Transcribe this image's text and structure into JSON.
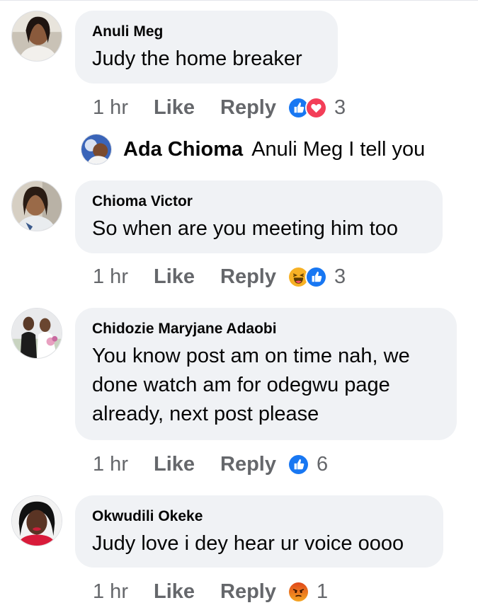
{
  "comments": [
    {
      "author": "Anuli Meg",
      "text": "Judy the home breaker",
      "time": "1 hr",
      "like_label": "Like",
      "reply_label": "Reply",
      "reactions": [
        "like-icon",
        "love-icon"
      ],
      "reaction_count": "3"
    },
    {
      "author": "Chioma Victor",
      "text": "So when are you meeting him too",
      "time": "1 hr",
      "like_label": "Like",
      "reply_label": "Reply",
      "reactions": [
        "haha-icon",
        "like-icon"
      ],
      "reaction_count": "3"
    },
    {
      "author": "Chidozie Maryjane Adaobi",
      "text": "You know post am on time nah, we done watch am for odegwu page already,  next post please",
      "time": "1 hr",
      "like_label": "Like",
      "reply_label": "Reply",
      "reactions": [
        "like-icon"
      ],
      "reaction_count": "6"
    },
    {
      "author": "Okwudili Okeke",
      "text": "Judy love i dey hear ur voice oooo",
      "time": "1 hr",
      "like_label": "Like",
      "reply_label": "Reply",
      "reactions": [
        "angry-icon"
      ],
      "reaction_count": "1"
    }
  ],
  "reply_preview": {
    "author": "Ada Chioma",
    "text": "Anuli Meg I tell you"
  },
  "colors": {
    "bubble": "#f0f2f5",
    "meta_text": "#65676b",
    "like_blue": "#1877f2",
    "love_red": "#f33e58",
    "haha_yellow": "#f7b125",
    "angry_orange": "#e9710f"
  }
}
